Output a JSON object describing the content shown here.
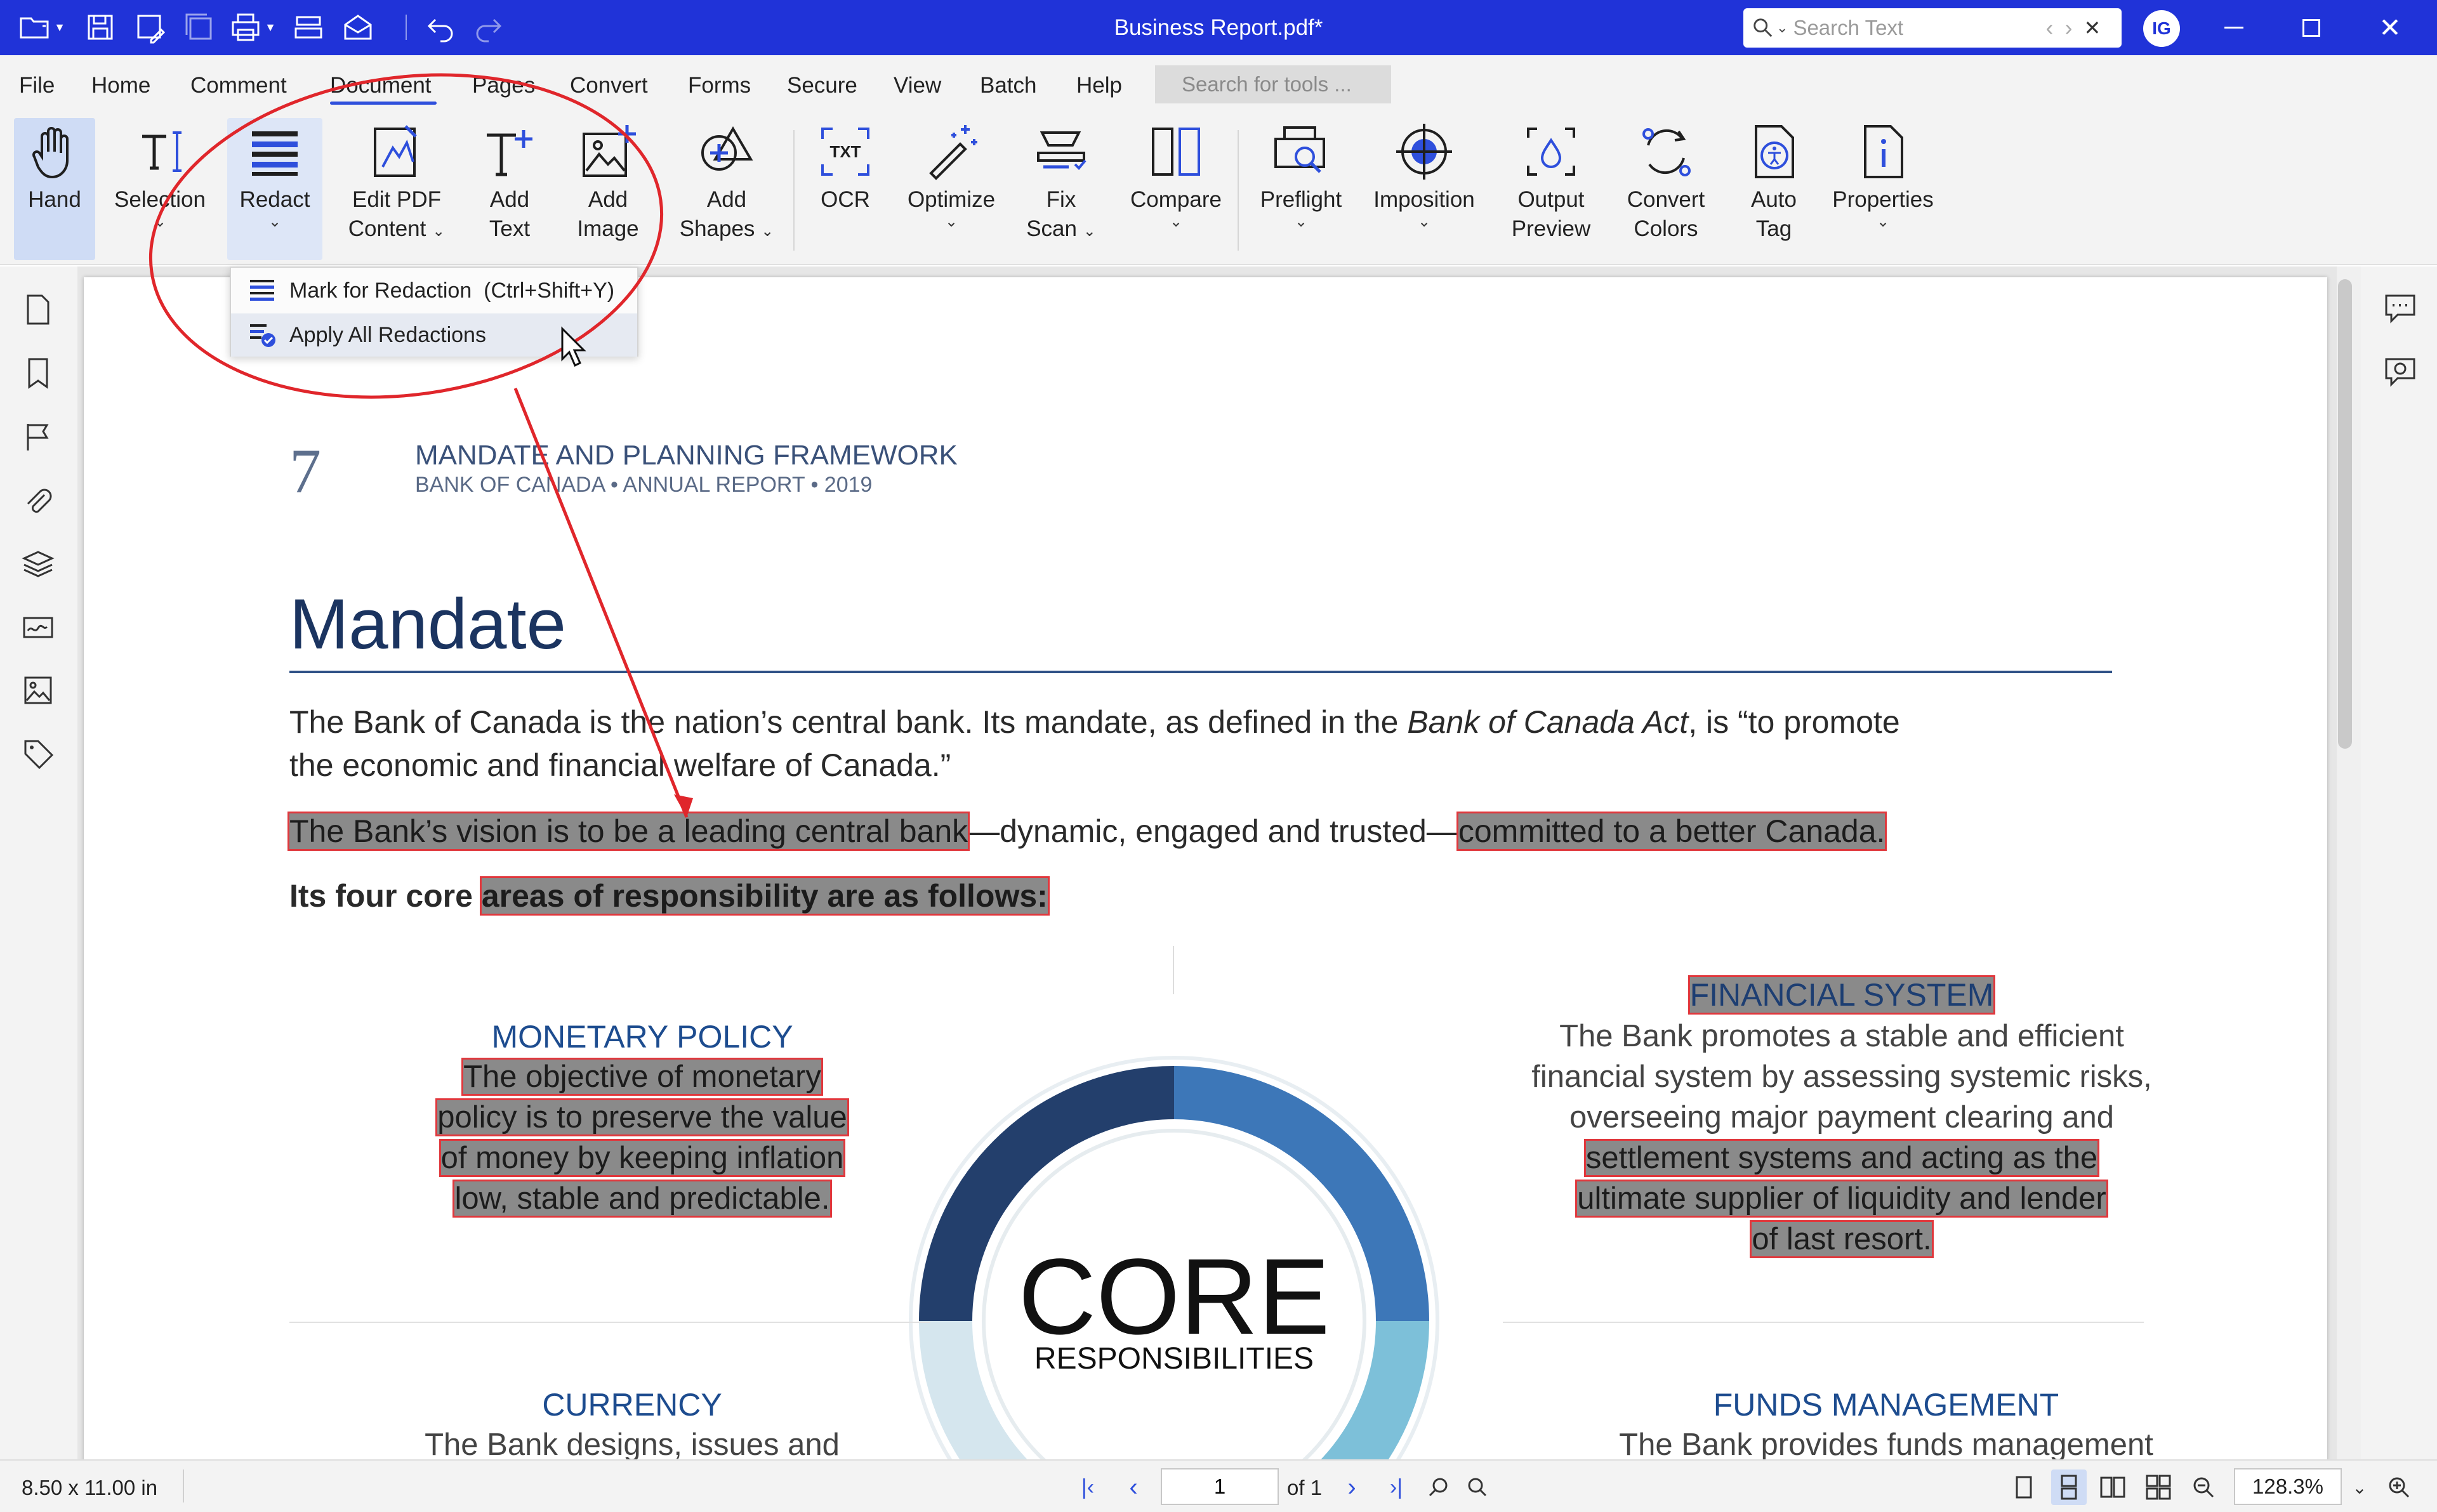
{
  "titlebar": {
    "doc_title": "Business Report.pdf*",
    "search_placeholder": "Search Text",
    "avatar_initials": "IG"
  },
  "menu": {
    "items": [
      "File",
      "Home",
      "Comment",
      "Document",
      "Pages",
      "Convert",
      "Forms",
      "Secure",
      "View",
      "Batch",
      "Help"
    ],
    "active": "Document",
    "tool_search_placeholder": "Search for tools ..."
  },
  "ribbon": {
    "tools": [
      {
        "line1": "Hand",
        "line2": "",
        "icon": "hand-icon"
      },
      {
        "line1": "Selection",
        "line2": "",
        "icon": "text-cursor-icon"
      },
      {
        "line1": "Redact",
        "line2": "",
        "icon": "redact-icon"
      },
      {
        "line1": "Edit PDF",
        "line2": "Content",
        "icon": "edit-content-icon"
      },
      {
        "line1": "Add",
        "line2": "Text",
        "icon": "add-text-icon"
      },
      {
        "line1": "Add",
        "line2": "Image",
        "icon": "add-image-icon"
      },
      {
        "line1": "Add",
        "line2": "Shapes",
        "icon": "add-shapes-icon"
      },
      {
        "line1": "OCR",
        "line2": "",
        "icon": "ocr-icon"
      },
      {
        "line1": "Optimize",
        "line2": "",
        "icon": "magic-wand-icon"
      },
      {
        "line1": "Fix",
        "line2": "Scan",
        "icon": "fix-scan-icon"
      },
      {
        "line1": "Compare",
        "line2": "",
        "icon": "compare-icon"
      },
      {
        "line1": "Preflight",
        "line2": "",
        "icon": "preflight-icon"
      },
      {
        "line1": "Imposition",
        "line2": "",
        "icon": "crosshair-icon"
      },
      {
        "line1": "Output",
        "line2": "Preview",
        "icon": "output-preview-icon"
      },
      {
        "line1": "Convert",
        "line2": "Colors",
        "icon": "convert-colors-icon"
      },
      {
        "line1": "Auto",
        "line2": "Tag",
        "icon": "auto-tag-icon"
      },
      {
        "line1": "Properties",
        "line2": "",
        "icon": "properties-icon"
      }
    ]
  },
  "redact_menu": {
    "items": [
      {
        "label": "Mark for Redaction",
        "shortcut": "(Ctrl+Shift+Y)"
      },
      {
        "label": "Apply All Redactions",
        "shortcut": ""
      }
    ]
  },
  "document": {
    "page_number": "7",
    "header_title": "MANDATE AND PLANNING FRAMEWORK",
    "header_sub": "BANK OF CANADA  •  ANNUAL REPORT  •  2019",
    "heading": "Mandate",
    "p1_a": "The Bank of Canada is the nation’s central bank. Its mandate, as defined in the ",
    "p1_italic": "Bank of Canada Act",
    "p1_b": ", is “to promote",
    "p1_line2": "the economic and financial welfare of Canada.”",
    "vision_red1": "The Bank’s vision is to be a leading central bank",
    "vision_mid": "—dynamic, engaged and trusted—",
    "vision_red2": "committed to a better Canada.",
    "core_a": "Its four core ",
    "core_red": "areas of responsibility are as follows:",
    "monetary_title": "MONETARY POLICY",
    "monetary_lines": [
      "The objective of monetary",
      "policy is to preserve the value",
      "of money by keeping inflation",
      "low, stable and predictable."
    ],
    "financial_title": "FINANCIAL SYSTEM",
    "financial_plain": [
      "The Bank promotes a stable and efficient",
      "financial system by assessing systemic risks,",
      "overseeing major payment clearing and"
    ],
    "financial_red": [
      "settlement systems and acting as the",
      "ultimate supplier of liquidity and lender",
      "of  last resort."
    ],
    "core_big": "CORE",
    "core_small": "RESPONSIBILITIES",
    "currency_title": "CURRENCY",
    "currency_text": "The Bank designs, issues and",
    "funds_title": "FUNDS MANAGEMENT",
    "funds_text": "The Bank provides funds management"
  },
  "statusbar": {
    "page_size": "8.50 x 11.00 in",
    "current_page": "1",
    "total_pages": "of 1",
    "zoom": "128.3%"
  },
  "colors": {
    "titlebar": "#2033d8",
    "accent": "#2e4fdc",
    "redaction_fill": "#8a8a8a",
    "redaction_border": "#e0383d",
    "navy": "#1b3460",
    "ring_dark": "#233f6c",
    "ring_mid": "#3d77b8",
    "ring_light": "#7dc0d9",
    "ring_pale": "#d5e6ee"
  }
}
